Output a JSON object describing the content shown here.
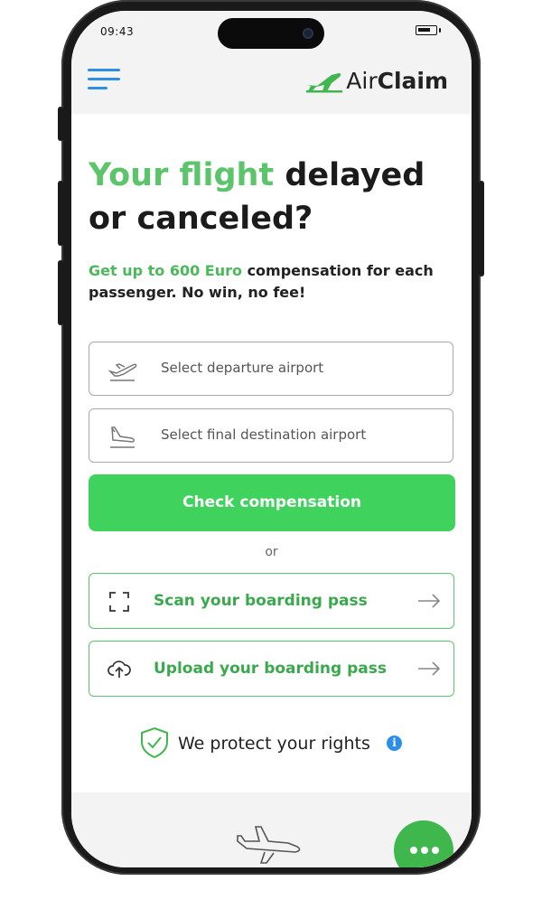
{
  "status_bar": {
    "time": "09:43"
  },
  "header": {
    "logo": {
      "prefix": "Air",
      "suffix": "Claim"
    }
  },
  "hero": {
    "headline_green": "Your flight",
    "headline_rest": " delayed or canceled?",
    "sub_green": "Get up to 600 Euro",
    "sub_rest": " compensation for each passenger. No win, no fee!"
  },
  "form": {
    "departure_placeholder": "Select departure airport",
    "destination_placeholder": "Select final destination airport",
    "cta_label": "Check compensation",
    "or_label": "or",
    "scan_label": "Scan your boarding pass",
    "upload_label": "Upload your boarding pass"
  },
  "trust": {
    "label": "We protect your rights",
    "info_glyph": "i"
  },
  "colors": {
    "brand_green": "#3fd25c",
    "text_green": "#5cc56b",
    "accent_blue": "#2b8fe6"
  },
  "icons": [
    "menu-icon",
    "plane-logo-icon",
    "takeoff-icon",
    "landing-icon",
    "scan-icon",
    "upload-cloud-icon",
    "arrow-right-icon",
    "shield-check-icon",
    "info-icon",
    "chat-dots-icon"
  ]
}
